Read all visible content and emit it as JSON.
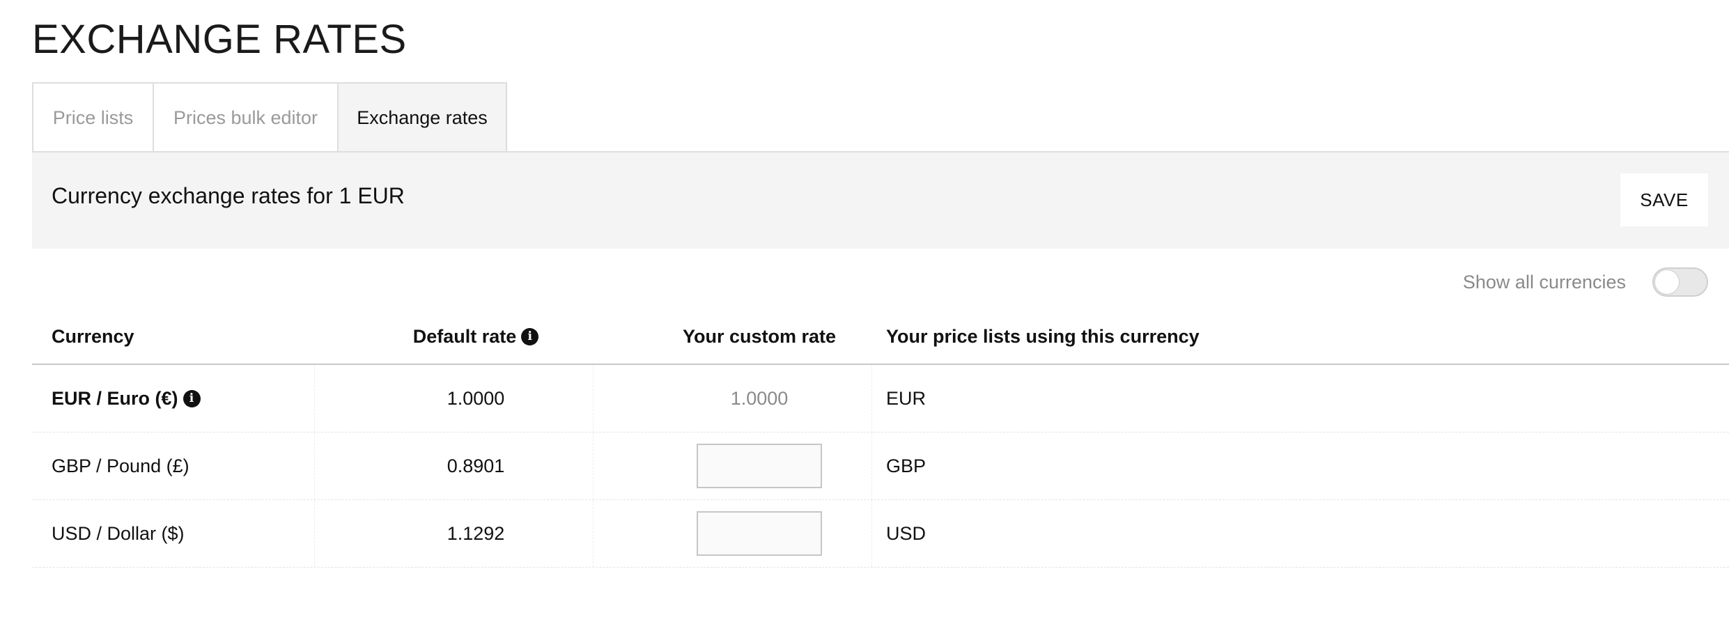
{
  "page": {
    "title": "EXCHANGE RATES"
  },
  "tabs": [
    {
      "label": "Price lists",
      "active": false
    },
    {
      "label": "Prices bulk editor",
      "active": false
    },
    {
      "label": "Exchange rates",
      "active": true
    }
  ],
  "panel": {
    "title": "Currency exchange rates for 1 EUR",
    "save_label": "SAVE"
  },
  "toggle": {
    "label": "Show all currencies",
    "on": false
  },
  "table": {
    "headers": {
      "currency": "Currency",
      "default_rate": "Default rate",
      "custom_rate": "Your custom rate",
      "price_lists": "Your price lists using this currency"
    },
    "rows": [
      {
        "currency": "EUR / Euro (€)",
        "default_rate": "1.0000",
        "custom_rate": "1.0000",
        "price_lists": "EUR",
        "base": true
      },
      {
        "currency": "GBP / Pound (£)",
        "default_rate": "0.8901",
        "custom_rate": "",
        "price_lists": "GBP",
        "base": false
      },
      {
        "currency": "USD / Dollar ($)",
        "default_rate": "1.1292",
        "custom_rate": "",
        "price_lists": "USD",
        "base": false
      }
    ]
  },
  "icons": {
    "info": "info-icon"
  },
  "colors": {
    "panel_background": "#f4f4f4",
    "border": "#dedede",
    "muted_text": "#8a8a8a"
  }
}
